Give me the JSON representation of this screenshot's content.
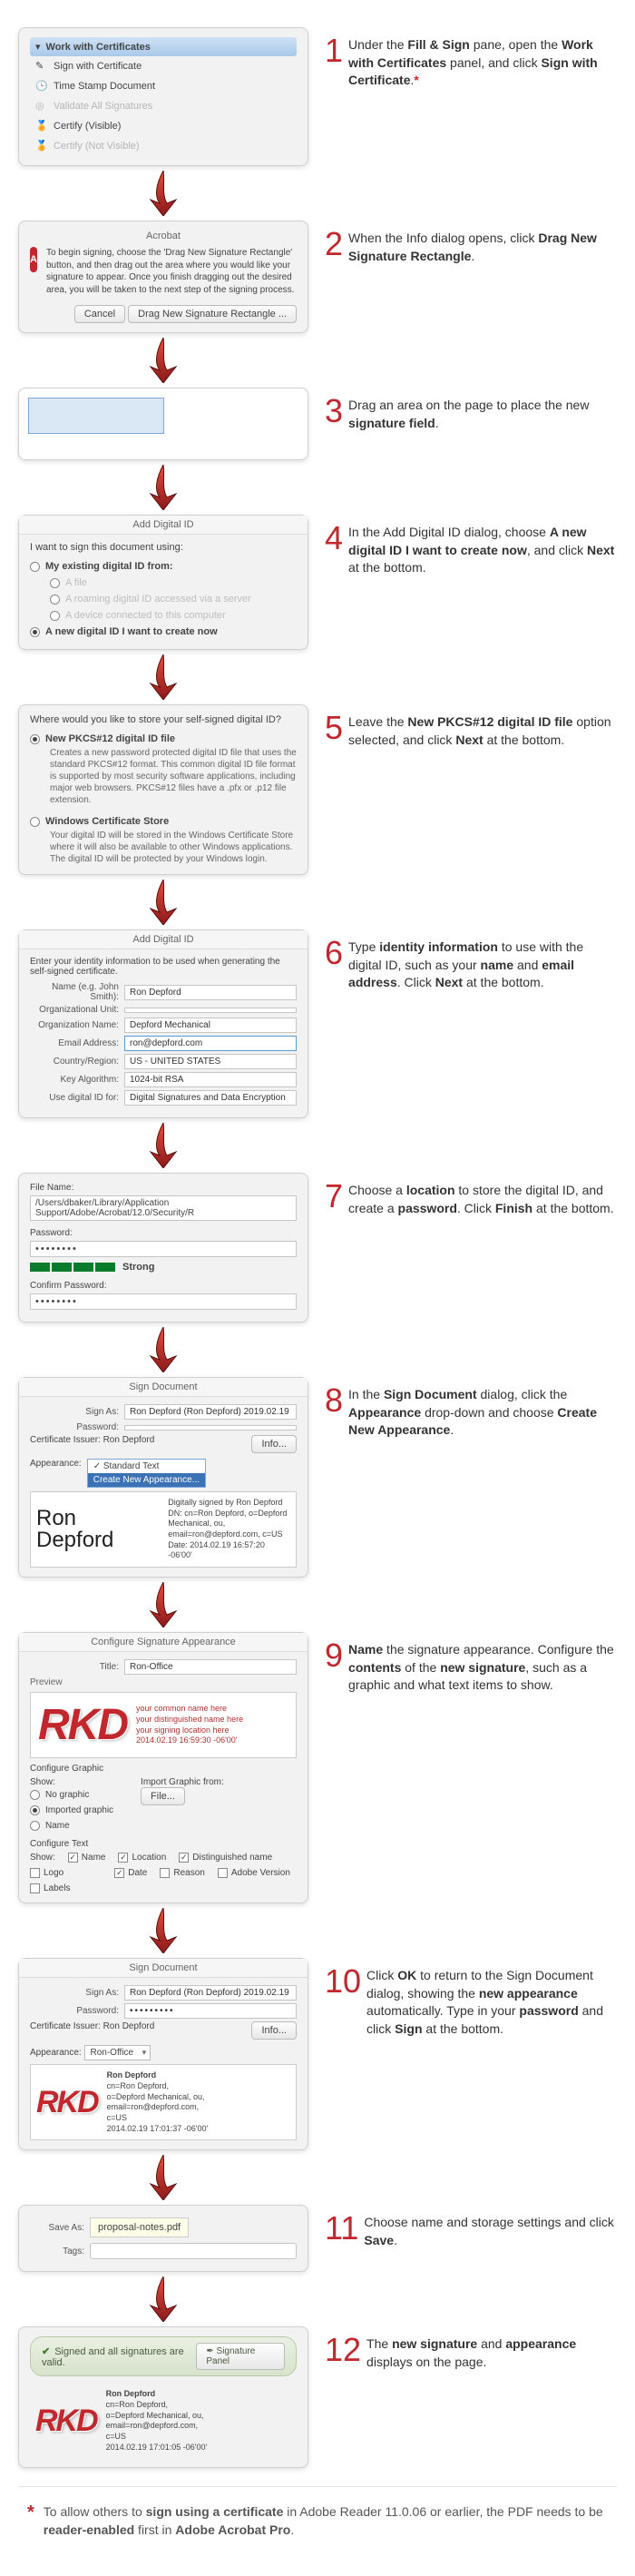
{
  "steps": [
    {
      "n": "1",
      "html": "Under the <b>Fill & Sign</b> pane, open the <b>Work with Certificates</b> panel, and click <b>Sign with Certificate</b>.<span class='star'>*</span>"
    },
    {
      "n": "2",
      "html": "When the Info dialog opens, click <b>Drag New Signature Rectangle</b>."
    },
    {
      "n": "3",
      "html": "Drag an area on the page to place the new <b>signature field</b>."
    },
    {
      "n": "4",
      "html": "In the Add Digital ID dialog, choose <b>A new digital ID I want to create now</b>, and click <b>Next</b> at the bottom."
    },
    {
      "n": "5",
      "html": "Leave the <b>New PKCS#12 digital ID file</b> option selected, and click <b>Next</b> at the bottom."
    },
    {
      "n": "6",
      "html": "Type <b>identity information</b> to use with the digital ID, such as your <b>name</b> and <b>email address</b>. Click <b>Next</b> at the bottom."
    },
    {
      "n": "7",
      "html": "Choose a <b>location</b> to store the digital ID, and create a <b>password</b>. Click <b>Finish</b> at the bottom."
    },
    {
      "n": "8",
      "html": "In the <b>Sign Document</b> dialog, click the <b>Appearance</b> drop-down and choose <b>Create New Appearance</b>."
    },
    {
      "n": "9",
      "html": "<b>Name</b> the signature appearance. Configure the <b>contents</b> of the <b>new signature</b>, such as a graphic and what text items to show."
    },
    {
      "n": "10",
      "html": "Click <b>OK</b> to return to the Sign Document dialog, showing the <b>new appearance</b> automatically. Type in your <b>password</b> and click <b>Sign</b> at the bottom."
    },
    {
      "n": "11",
      "html": "Choose name and storage settings and click <b>Save</b>."
    },
    {
      "n": "12",
      "html": "The <b>new signature</b> and <b>appearance</b> displays on the page."
    }
  ],
  "s1": {
    "header": "Work with Certificates",
    "items": [
      "Sign with Certificate",
      "Time Stamp Document",
      "Validate All Signatures",
      "Certify (Visible)",
      "Certify (Not Visible)"
    ]
  },
  "s2": {
    "title": "Acrobat",
    "body": "To begin signing, choose the 'Drag New Signature Rectangle' button, and then drag out the area where you would like your signature to appear. Once you finish dragging out the desired area, you will be taken to the next step of the signing process.",
    "cancel": "Cancel",
    "drag": "Drag New Signature Rectangle ..."
  },
  "s4": {
    "title": "Add Digital ID",
    "lead": "I want to sign this document using:",
    "o1": "My existing digital ID from:",
    "o1a": "A file",
    "o1b": "A roaming digital ID accessed via a server",
    "o1c": "A device connected to this computer",
    "o2": "A new digital ID I want to create now"
  },
  "s5": {
    "lead": "Where would you like to store your self-signed digital ID?",
    "o1": "New PKCS#12 digital ID file",
    "o1d": "Creates a new password protected digital ID file that uses the standard PKCS#12 format. This common digital ID file format is supported by most security software applications, including major web browsers. PKCS#12 files have a .pfx or .p12 file extension.",
    "o2": "Windows Certificate Store",
    "o2d": "Your digital ID will be stored in the Windows Certificate Store where it will also be available to other Windows applications. The digital ID will be protected by your Windows login."
  },
  "s6": {
    "title": "Add Digital ID",
    "lead": "Enter your identity information to be used when generating the self-signed certificate.",
    "fields": {
      "name_l": "Name (e.g. John Smith):",
      "name_v": "Ron Depford",
      "ou_l": "Organizational Unit:",
      "ou_v": "",
      "org_l": "Organization Name:",
      "org_v": "Depford Mechanical",
      "em_l": "Email Address:",
      "em_v": "ron@depford.com",
      "cr_l": "Country/Region:",
      "cr_v": "US - UNITED STATES",
      "ka_l": "Key Algorithm:",
      "ka_v": "1024-bit RSA",
      "use_l": "Use digital ID for:",
      "use_v": "Digital Signatures and Data Encryption"
    }
  },
  "s7": {
    "fn_l": "File Name:",
    "fn_v": "/Users/dbaker/Library/Application Support/Adobe/Acrobat/12.0/Security/R",
    "pw_l": "Password:",
    "pw_v": "••••••••",
    "str": "Strong",
    "cpw_l": "Confirm Password:",
    "cpw_v": "••••••••"
  },
  "s8": {
    "title": "Sign Document",
    "sa_l": "Sign As:",
    "sa_v": "Ron Depford (Ron Depford) 2019.02.19",
    "pw_l": "Password:",
    "iss_l": "Certificate Issuer: Ron Depford",
    "info": "Info...",
    "ap_l": "Appearance:",
    "dd1": "Standard Text",
    "dd2": "Create New Appearance...",
    "name": "Ron Depford",
    "meta": "Digitally signed by Ron Depford\nDN: cn=Ron Depford, o=Depford\nMechanical, ou,\nemail=ron@depford.com, c=US\nDate: 2014.02.19 16:57:20 -06'00'"
  },
  "s9": {
    "title": "Configure Signature Appearance",
    "t_l": "Title:",
    "t_v": "Ron-Office",
    "pv": "Preview",
    "pv_lines": "your common name here\nyour distinguished name here\nyour signing location here\n2014.02.19 16:59:30 -06'00'",
    "cg": "Configure Graphic",
    "show": "Show:",
    "g1": "No graphic",
    "g2": "Imported graphic",
    "g3": "Name",
    "imp": "Import Graphic from:",
    "file": "File...",
    "ct": "Configure Text",
    "cks": [
      "Name",
      "Location",
      "Distinguished name",
      "Logo",
      "Date",
      "Reason",
      "Adobe Version",
      "Labels"
    ]
  },
  "s10": {
    "title": "Sign Document",
    "sa_l": "Sign As:",
    "sa_v": "Ron Depford (Ron Depford) 2019.02.19",
    "pw_l": "Password:",
    "pw_v": "•••••••••",
    "iss_l": "Certificate Issuer: Ron Depford",
    "info": "Info...",
    "ap_l": "Appearance:",
    "ap_v": "Ron-Office",
    "name": "Ron Depford",
    "meta": "cn=Ron Depford,\no=Depford Mechanical, ou,\nemail=ron@depford.com,\nc=US\n2014.02.19 17:01:37 -06'00'"
  },
  "s11": {
    "sa_l": "Save As:",
    "sa_v": "proposal-notes.pdf",
    "tg_l": "Tags:"
  },
  "s12": {
    "bar": "Signed and all signatures are valid.",
    "panel": "Signature Panel",
    "name": "Ron Depford",
    "meta": "cn=Ron Depford,\no=Depford Mechanical, ou,\nemail=ron@depford.com,\nc=US\n2014.02.19 17:01:05 -06'00'"
  },
  "foot": "To allow others to <b>sign using a certificate</b> in Adobe Reader 11.0.06 or earlier, the PDF needs to be <b>reader-enabled</b> first in <b>Adobe Acrobat Pro</b>."
}
